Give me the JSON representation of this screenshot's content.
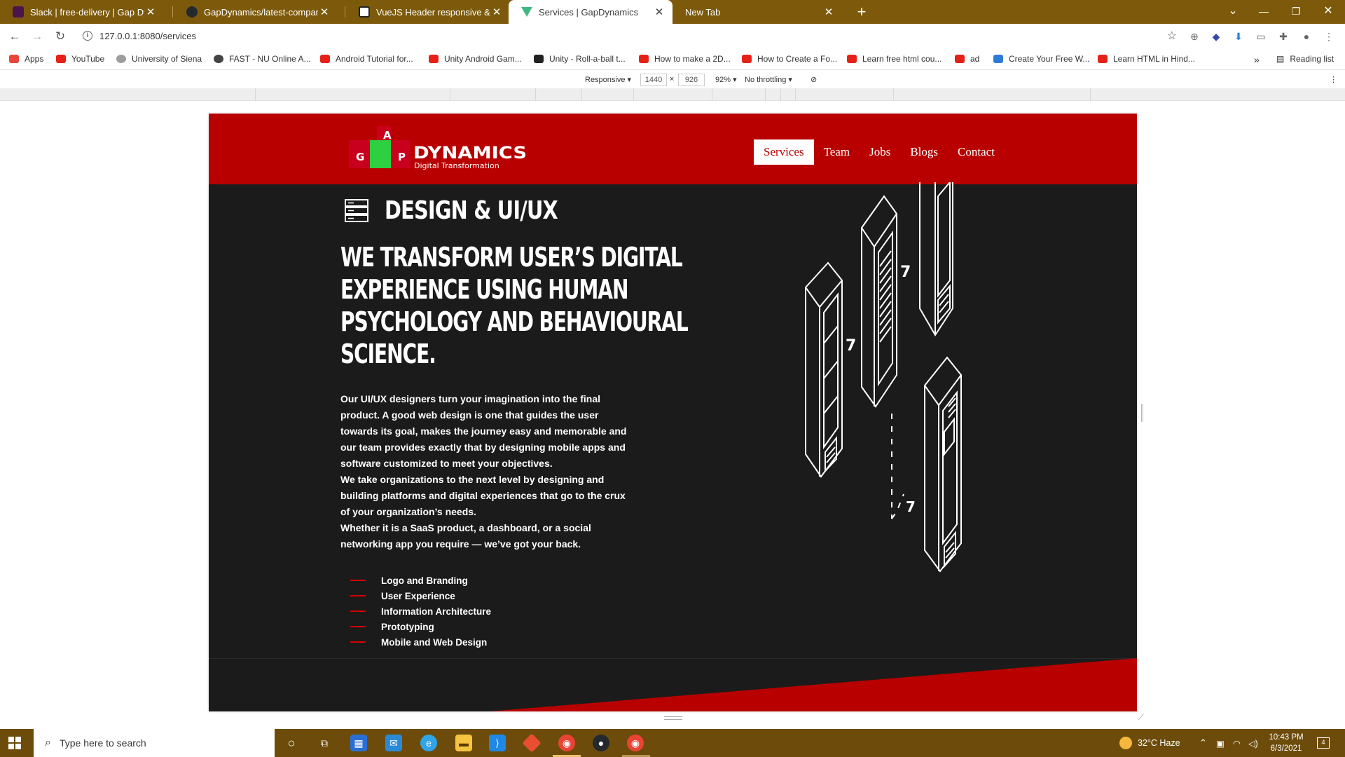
{
  "browser": {
    "tabs": [
      {
        "title": "Slack | free-delivery | Gap Dynam",
        "color": "#4a154b",
        "icon": "slack-icon"
      },
      {
        "title": "GapDynamics/latest-company-w",
        "color": "#24292e",
        "icon": "github-icon"
      },
      {
        "title": "VueJS Header responsive & Load",
        "color": "#333333",
        "icon": "codepen-icon"
      },
      {
        "title": "Services | GapDynamics",
        "color": "#41b883",
        "icon": "vue-icon"
      },
      {
        "title": "New Tab",
        "color": "",
        "icon": ""
      }
    ],
    "url": "127.0.0.1:8080/services",
    "bookmarks": [
      {
        "label": "Apps",
        "color": "#e8453c"
      },
      {
        "label": "YouTube",
        "color": "#e62117"
      },
      {
        "label": "University of Siena",
        "color": "#9e9e9e"
      },
      {
        "label": "FAST - NU Online A...",
        "color": "#444444"
      },
      {
        "label": "Android Tutorial for...",
        "color": "#e62117"
      },
      {
        "label": "Unity Android Gam...",
        "color": "#e62117"
      },
      {
        "label": "Unity - Roll-a-ball t...",
        "color": "#222222"
      },
      {
        "label": "How to make a 2D...",
        "color": "#e62117"
      },
      {
        "label": "How to Create a Fo...",
        "color": "#e62117"
      },
      {
        "label": "Learn free html cou...",
        "color": "#e62117"
      },
      {
        "label": "ad",
        "color": "#e62117"
      },
      {
        "label": "Create Your Free W...",
        "color": "#2e7bd6"
      },
      {
        "label": "Learn HTML in Hind...",
        "color": "#e62117"
      }
    ],
    "overflow": "»",
    "reading_list": "Reading list"
  },
  "devtools": {
    "device": "Responsive ▾",
    "width": "1440",
    "times": "×",
    "height": "926",
    "zoom": "92% ▾",
    "throttling": "No throttling ▾"
  },
  "site": {
    "logo": {
      "letters": [
        "A",
        "G",
        "P"
      ],
      "brand": "DYNAMICS",
      "tagline": "Digital Transformation"
    },
    "nav": [
      "Services",
      "Team",
      "Jobs",
      "Blogs",
      "Contact"
    ],
    "section_title": "DESIGN & UI/UX",
    "headline": [
      "WE TRANSFORM USER’S DIGITAL",
      "EXPERIENCE USING HUMAN",
      "PSYCHOLOGY AND BEHAVIOURAL",
      "SCIENCE."
    ],
    "paragraph": [
      "Our UI/UX designers turn your imagination into the final product. A good web design is one that guides the user towards its goal, makes the journey easy and memorable and our team provides exactly that by designing mobile apps and software customized to meet your objectives.",
      "We take organizations to the next level by designing and building platforms and digital experiences that go to the crux of your organization’s needs.",
      "Whether it is a SaaS product, a dashboard, or a social networking app you require — we’ve got your back."
    ],
    "services": [
      "Logo and Branding",
      "User Experience",
      "Information Architecture",
      "Prototyping",
      "Mobile and Web Design"
    ]
  },
  "taskbar": {
    "search_placeholder": "Type here to search",
    "weather": "32°C  Haze",
    "time": "10:43 PM",
    "date": "6/3/2021",
    "notifications": "4"
  }
}
